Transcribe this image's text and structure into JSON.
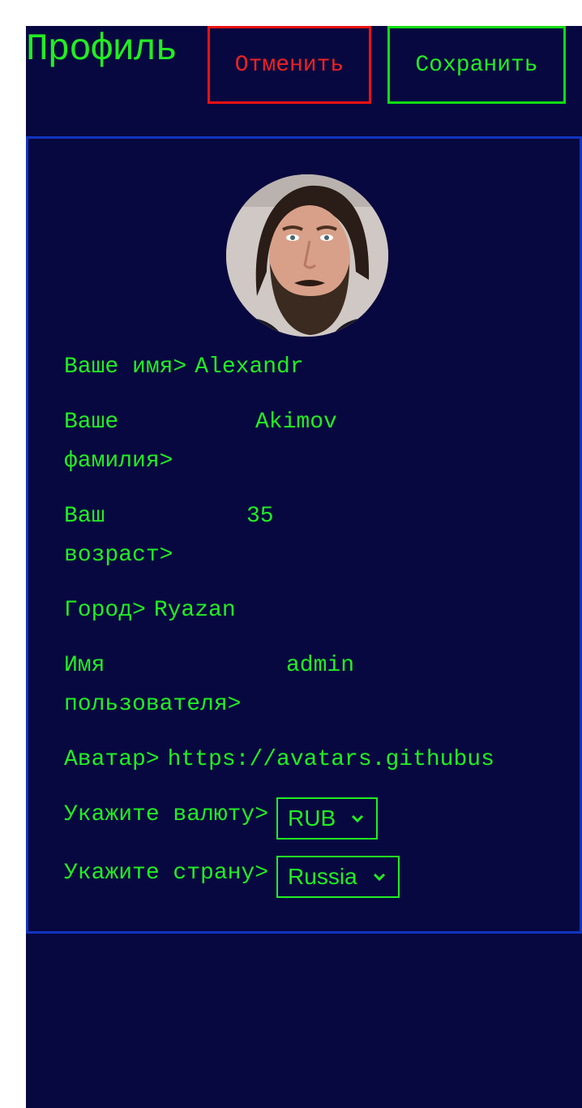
{
  "header": {
    "title": "Профиль",
    "cancel_label": "Отменить",
    "save_label": "Сохранить"
  },
  "profile": {
    "first_name_label": "Ваше имя>",
    "first_name_value": "Alexandr",
    "last_name_label_line1": "Ваше",
    "last_name_label_line2": "фамилия>",
    "last_name_value": "Akimov",
    "age_label_line1": "Ваш",
    "age_label_line2": "возраст>",
    "age_value": "35",
    "city_label": "Город>",
    "city_value": "Ryazan",
    "username_label_line1": "Имя",
    "username_label_line2": "пользователя>",
    "username_value": "admin",
    "avatar_label": "Аватар>",
    "avatar_value": "https://avatars.githubus",
    "currency_label": "Укажите валюту>",
    "currency_value": "RUB",
    "country_label": "Укажите страну>",
    "country_value": "Russia"
  },
  "icons": {
    "avatar": "avatar-image",
    "select_chevron": "chevron-down-icon"
  },
  "colors": {
    "background": "#080840",
    "text": "#22ee22",
    "cancel": "#ee1111",
    "save": "#11dd11",
    "card_border": "#1034c0"
  }
}
